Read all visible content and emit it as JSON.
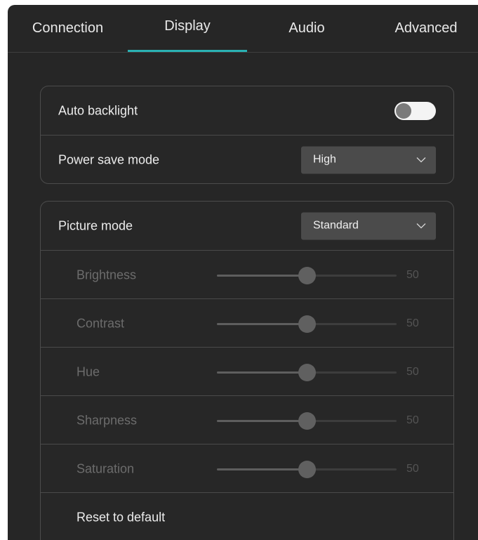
{
  "tabs": [
    {
      "label": "Connection"
    },
    {
      "label": "Display",
      "active": true
    },
    {
      "label": "Audio"
    },
    {
      "label": "Advanced"
    }
  ],
  "accent_color": "#2ab1b3",
  "power_settings": {
    "auto_backlight": {
      "label": "Auto backlight",
      "enabled": false
    },
    "power_save_mode": {
      "label": "Power save mode",
      "value": "High"
    }
  },
  "picture": {
    "picture_mode": {
      "label": "Picture mode",
      "value": "Standard"
    },
    "sliders": [
      {
        "label": "Brightness",
        "value": "50",
        "level": 0.5
      },
      {
        "label": "Contrast",
        "value": "50",
        "level": 0.5
      },
      {
        "label": "Hue",
        "value": "50",
        "level": 0.5
      },
      {
        "label": "Sharpness",
        "value": "50",
        "level": 0.5
      },
      {
        "label": "Saturation",
        "value": "50",
        "level": 0.5
      }
    ],
    "reset_label": "Reset to default"
  }
}
